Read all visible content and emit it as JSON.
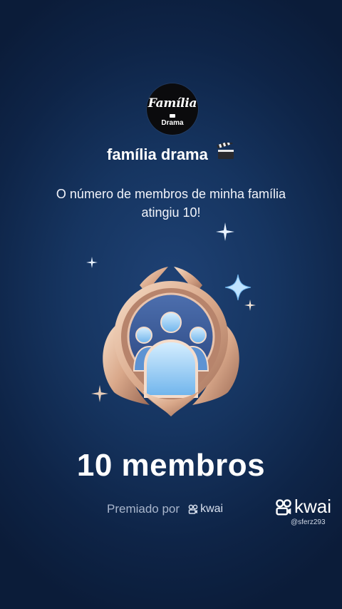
{
  "logo": {
    "line1": "Família",
    "line2": "Drama"
  },
  "family": {
    "name": "família drama"
  },
  "message": "O número de membros de minha família atingiu 10!",
  "badge": {
    "icon": "family-members-badge"
  },
  "milestone": {
    "count_text": "10 membros"
  },
  "awarded": {
    "label": "Premiado por",
    "brand": "kwai"
  },
  "watermark": {
    "brand": "kwai",
    "user": "@sferz293"
  },
  "colors": {
    "background": "#163561",
    "badge_gold": "#d9a88a",
    "badge_blue": "#6fb4ec",
    "star": "#bfe3ff"
  }
}
